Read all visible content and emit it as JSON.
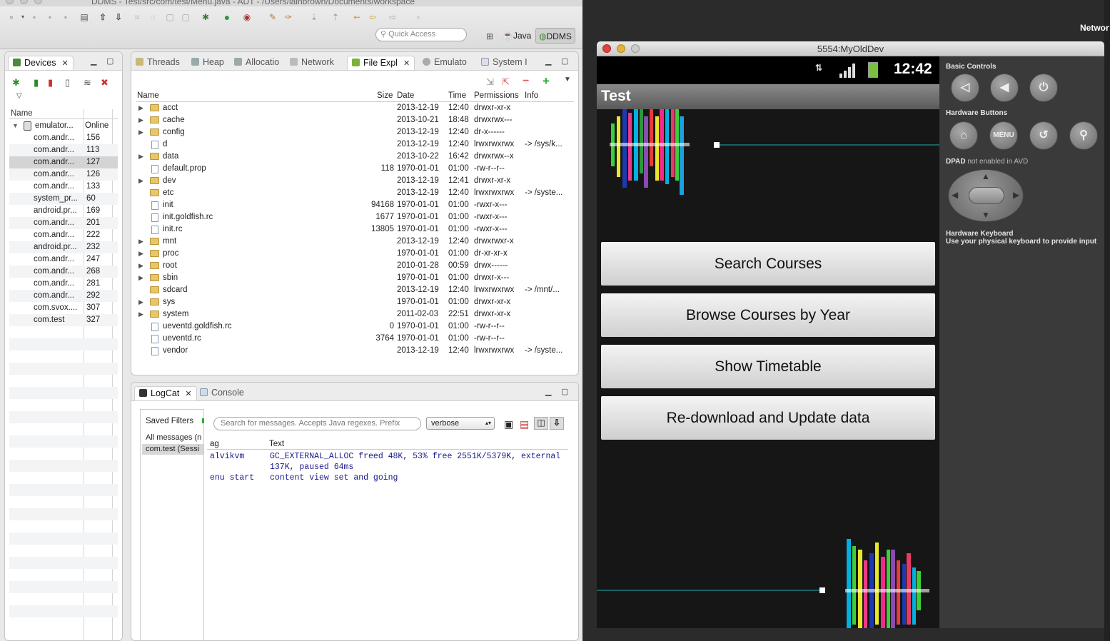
{
  "window": {
    "title": "DDMS - Test/src/com/test/Menu.java - ADT - /Users/iainbrown/Documents/workspace"
  },
  "toolbar": {
    "quick_access_placeholder": "Quick Access",
    "perspective_java": "Java",
    "perspective_ddms": "DDMS"
  },
  "devices": {
    "tab_label": "Devices",
    "columns": [
      "Name",
      "Online"
    ],
    "emulator": {
      "name": "emulator...",
      "status": "Online"
    },
    "processes": [
      {
        "name": "com.andr...",
        "pid": "156"
      },
      {
        "name": "com.andr...",
        "pid": "113"
      },
      {
        "name": "com.andr...",
        "pid": "127"
      },
      {
        "name": "com.andr...",
        "pid": "126"
      },
      {
        "name": "com.andr...",
        "pid": "133"
      },
      {
        "name": "system_pr...",
        "pid": "60"
      },
      {
        "name": "android.pr...",
        "pid": "169"
      },
      {
        "name": "com.andr...",
        "pid": "201"
      },
      {
        "name": "com.andr...",
        "pid": "222"
      },
      {
        "name": "android.pr...",
        "pid": "232"
      },
      {
        "name": "com.andr...",
        "pid": "247"
      },
      {
        "name": "com.andr...",
        "pid": "268"
      },
      {
        "name": "com.andr...",
        "pid": "281"
      },
      {
        "name": "com.andr...",
        "pid": "292"
      },
      {
        "name": "com.svox....",
        "pid": "307"
      },
      {
        "name": "com.test",
        "pid": "327"
      }
    ]
  },
  "tools_tabs": [
    "Threads",
    "Heap",
    "Allocatio",
    "Network",
    "File Expl",
    "Emulato",
    "System I"
  ],
  "file_explorer": {
    "columns": [
      "Name",
      "Size",
      "Date",
      "Time",
      "Permissions",
      "Info"
    ],
    "rows": [
      {
        "name": "acct",
        "folder": true,
        "expand": true,
        "size": "",
        "date": "2013-12-19",
        "time": "12:40",
        "perm": "drwxr-xr-x",
        "info": ""
      },
      {
        "name": "cache",
        "folder": true,
        "expand": true,
        "size": "",
        "date": "2013-10-21",
        "time": "18:48",
        "perm": "drwxrwx---",
        "info": ""
      },
      {
        "name": "config",
        "folder": true,
        "expand": true,
        "size": "",
        "date": "2013-12-19",
        "time": "12:40",
        "perm": "dr-x------",
        "info": ""
      },
      {
        "name": "d",
        "folder": false,
        "expand": false,
        "size": "",
        "date": "2013-12-19",
        "time": "12:40",
        "perm": "lrwxrwxrwx",
        "info": "-> /sys/k..."
      },
      {
        "name": "data",
        "folder": true,
        "expand": true,
        "size": "",
        "date": "2013-10-22",
        "time": "16:42",
        "perm": "drwxrwx--x",
        "info": ""
      },
      {
        "name": "default.prop",
        "folder": false,
        "expand": false,
        "size": "118",
        "date": "1970-01-01",
        "time": "01:00",
        "perm": "-rw-r--r--",
        "info": ""
      },
      {
        "name": "dev",
        "folder": true,
        "expand": true,
        "size": "",
        "date": "2013-12-19",
        "time": "12:41",
        "perm": "drwxr-xr-x",
        "info": ""
      },
      {
        "name": "etc",
        "folder": true,
        "expand": false,
        "size": "",
        "date": "2013-12-19",
        "time": "12:40",
        "perm": "lrwxrwxrwx",
        "info": "-> /syste..."
      },
      {
        "name": "init",
        "folder": false,
        "expand": false,
        "size": "94168",
        "date": "1970-01-01",
        "time": "01:00",
        "perm": "-rwxr-x---",
        "info": ""
      },
      {
        "name": "init.goldfish.rc",
        "folder": false,
        "expand": false,
        "size": "1677",
        "date": "1970-01-01",
        "time": "01:00",
        "perm": "-rwxr-x---",
        "info": ""
      },
      {
        "name": "init.rc",
        "folder": false,
        "expand": false,
        "size": "13805",
        "date": "1970-01-01",
        "time": "01:00",
        "perm": "-rwxr-x---",
        "info": ""
      },
      {
        "name": "mnt",
        "folder": true,
        "expand": true,
        "size": "",
        "date": "2013-12-19",
        "time": "12:40",
        "perm": "drwxrwxr-x",
        "info": ""
      },
      {
        "name": "proc",
        "folder": true,
        "expand": true,
        "size": "",
        "date": "1970-01-01",
        "time": "01:00",
        "perm": "dr-xr-xr-x",
        "info": ""
      },
      {
        "name": "root",
        "folder": true,
        "expand": true,
        "size": "",
        "date": "2010-01-28",
        "time": "00:59",
        "perm": "drwx------",
        "info": ""
      },
      {
        "name": "sbin",
        "folder": true,
        "expand": true,
        "size": "",
        "date": "1970-01-01",
        "time": "01:00",
        "perm": "drwxr-x---",
        "info": ""
      },
      {
        "name": "sdcard",
        "folder": true,
        "expand": false,
        "size": "",
        "date": "2013-12-19",
        "time": "12:40",
        "perm": "lrwxrwxrwx",
        "info": "-> /mnt/..."
      },
      {
        "name": "sys",
        "folder": true,
        "expand": true,
        "size": "",
        "date": "1970-01-01",
        "time": "01:00",
        "perm": "drwxr-xr-x",
        "info": ""
      },
      {
        "name": "system",
        "folder": true,
        "expand": true,
        "size": "",
        "date": "2011-02-03",
        "time": "22:51",
        "perm": "drwxr-xr-x",
        "info": ""
      },
      {
        "name": "ueventd.goldfish.rc",
        "folder": false,
        "expand": false,
        "size": "0",
        "date": "1970-01-01",
        "time": "01:00",
        "perm": "-rw-r--r--",
        "info": ""
      },
      {
        "name": "ueventd.rc",
        "folder": false,
        "expand": false,
        "size": "3764",
        "date": "1970-01-01",
        "time": "01:00",
        "perm": "-rw-r--r--",
        "info": ""
      },
      {
        "name": "vendor",
        "folder": false,
        "expand": false,
        "size": "",
        "date": "2013-12-19",
        "time": "12:40",
        "perm": "lrwxrwxrwx",
        "info": "-> /syste..."
      }
    ]
  },
  "logcat": {
    "tab_label": "LogCat",
    "console_label": "Console",
    "saved_filters_label": "Saved Filters",
    "filters": [
      "All messages (n",
      "com.test (Sessi"
    ],
    "search_placeholder": "Search for messages. Accepts Java regexes. Prefix",
    "level": "verbose",
    "columns": [
      "ag",
      "Text"
    ],
    "lines": [
      {
        "tag": "alvikvm",
        "text": "GC_EXTERNAL_ALLOC freed 48K, 53% free 2551K/5379K, external"
      },
      {
        "tag": "",
        "text": "137K, paused 64ms"
      },
      {
        "tag": "enu start",
        "text": "content view set and going"
      }
    ]
  },
  "emulator": {
    "title": "5554:MyOldDev",
    "time": "12:42",
    "app_title": "Test",
    "buttons": [
      "Search Courses",
      "Browse Courses by Year",
      "Show Timetable",
      "Re-download and Update data"
    ],
    "basic_controls": "Basic Controls",
    "hardware_buttons": "Hardware Buttons",
    "menu_label": "MENU",
    "dpad_label": "DPAD",
    "dpad_note": "not enabled in AVD",
    "keyboard_title": "Hardware Keyboard",
    "keyboard_note": "Use your physical keyboard to provide input"
  },
  "edge_text": "Networ"
}
